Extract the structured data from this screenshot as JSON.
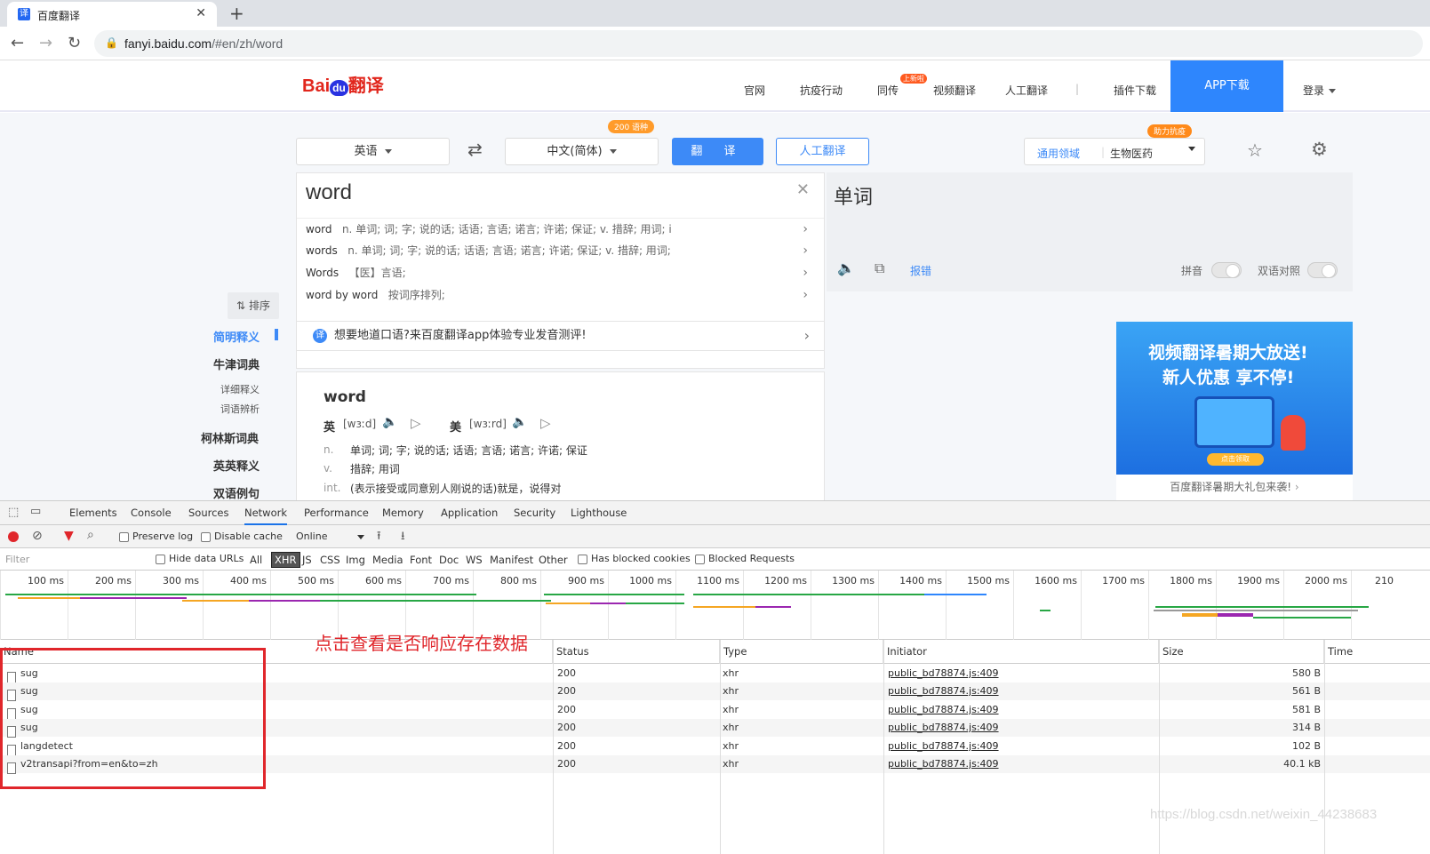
{
  "browser": {
    "tab_title": "百度翻译",
    "url_host": "fanyi.baidu.com",
    "url_path": "/#en/zh/word"
  },
  "header": {
    "logo_bai": "Bai",
    "logo_du": "du",
    "logo_fanyi": "翻译",
    "nav": [
      "官网",
      "抗疫行动",
      "同传",
      "视频翻译",
      "人工翻译",
      "|",
      "插件下载"
    ],
    "new_badge": "上新啦",
    "app_download": "APP下载",
    "login": "登录"
  },
  "translator": {
    "from_lang": "英语",
    "to_lang": "中文(简体)",
    "lang_count_badge": "200 语种",
    "translate_btn": "翻 译",
    "human_btn": "人工翻译",
    "domain_badge": "助力抗疫",
    "domain_general": "通用领域",
    "domain_selected": "生物医药",
    "input_text": "word",
    "suggestions": [
      {
        "key": "word",
        "desc": "n. 单词; 词; 字; 说的话; 话语; 言语; 诺言; 许诺; 保证; v. 措辞; 用词; i"
      },
      {
        "key": "words",
        "desc": "n. 单词; 词; 字; 说的话; 话语; 言语; 诺言; 许诺; 保证; v. 措辞; 用词;"
      },
      {
        "key": "Words",
        "desc": "【医】言语;"
      },
      {
        "key": "word by word",
        "desc": "按词序排列;"
      }
    ],
    "result": "单词",
    "report_error": "报错",
    "pinyin": "拼音",
    "bilingual": "双语对照"
  },
  "sidebar": {
    "sort": "排序",
    "items": [
      "简明释义",
      "牛津词典",
      "详细释义",
      "词语辨析",
      "柯林斯词典",
      "英英释义",
      "双语例句"
    ]
  },
  "promo_text": "想要地道口语?来百度翻译app体验专业发音测评!",
  "dictionary": {
    "word": "word",
    "uk_label": "英",
    "uk_phon": "[wɜːd]",
    "us_label": "美",
    "us_phon": "[wɜːrd]",
    "defs": [
      {
        "pos": "n.",
        "text": "单词;  词;  字;  说的话;  话语;  言语;  诺言;  许诺;  保证"
      },
      {
        "pos": "v.",
        "text": "措辞;  用词"
      },
      {
        "pos": "int.",
        "text": "(表示接受或同意别人刚说的话)就是，说得对"
      }
    ]
  },
  "ad": {
    "line1": "视频翻译暑期大放送!",
    "line2": "新人优惠 享不停!",
    "button": "点击领取",
    "caption": "百度翻译暑期大礼包来袭!"
  },
  "devtools": {
    "tabs": [
      "Elements",
      "Console",
      "Sources",
      "Network",
      "Performance",
      "Memory",
      "Application",
      "Security",
      "Lighthouse"
    ],
    "active_tab": "Network",
    "preserve_log": "Preserve log",
    "disable_cache": "Disable cache",
    "throttle": "Online",
    "filter_placeholder": "Filter",
    "hide_data_urls": "Hide data URLs",
    "types": [
      "All",
      "XHR",
      "JS",
      "CSS",
      "Img",
      "Media",
      "Font",
      "Doc",
      "WS",
      "Manifest",
      "Other"
    ],
    "active_type": "XHR",
    "has_blocked_cookies": "Has blocked cookies",
    "blocked_requests": "Blocked Requests",
    "timeline_ticks": [
      "100 ms",
      "200 ms",
      "300 ms",
      "400 ms",
      "500 ms",
      "600 ms",
      "700 ms",
      "800 ms",
      "900 ms",
      "1000 ms",
      "1100 ms",
      "1200 ms",
      "1300 ms",
      "1400 ms",
      "1500 ms",
      "1600 ms",
      "1700 ms",
      "1800 ms",
      "1900 ms",
      "2000 ms",
      "210"
    ],
    "columns": [
      "Name",
      "Status",
      "Type",
      "Initiator",
      "Size",
      "Time"
    ],
    "rows": [
      {
        "name": "sug",
        "status": "200",
        "type": "xhr",
        "initiator": "public_bd78874.js:409",
        "size": "580 B"
      },
      {
        "name": "sug",
        "status": "200",
        "type": "xhr",
        "initiator": "public_bd78874.js:409",
        "size": "561 B"
      },
      {
        "name": "sug",
        "status": "200",
        "type": "xhr",
        "initiator": "public_bd78874.js:409",
        "size": "581 B"
      },
      {
        "name": "sug",
        "status": "200",
        "type": "xhr",
        "initiator": "public_bd78874.js:409",
        "size": "314 B"
      },
      {
        "name": "langdetect",
        "status": "200",
        "type": "xhr",
        "initiator": "public_bd78874.js:409",
        "size": "102 B"
      },
      {
        "name": "v2transapi?from=en&to=zh",
        "status": "200",
        "type": "xhr",
        "initiator": "public_bd78874.js:409",
        "size": "40.1 kB"
      }
    ]
  },
  "annotation": "点击查看是否响应存在数据",
  "watermark": "https://blog.csdn.net/weixin_44238683",
  "colors": {
    "accent": "#3d8af7",
    "annotation_red": "#e0262b",
    "baidu_red": "#e1261c"
  }
}
